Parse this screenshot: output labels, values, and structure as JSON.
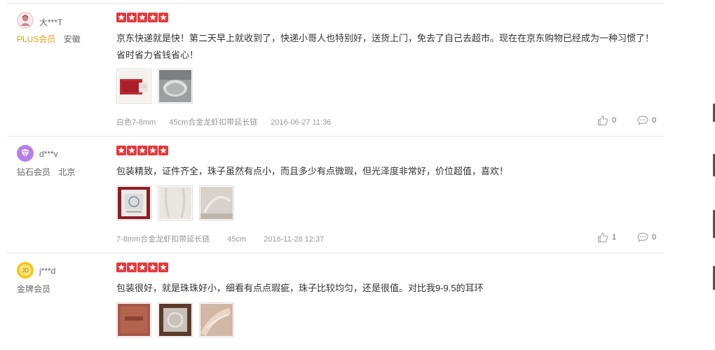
{
  "reviews": [
    {
      "user": "大***T",
      "level": "PLUS会员",
      "location": "安徽",
      "rating": 5,
      "content": "京东快递就是快！第二天早上就收到了，快递小哥人也特别好，送货上门，免去了自己去超市。现在在京东购物已经成为一种习惯了！省时省力省钱省心！",
      "specs": [
        "白色7-8mm",
        "45cm合金龙虾扣带延长链"
      ],
      "date": "2016-06-27 11:36",
      "likes": "0",
      "replies": "0"
    },
    {
      "user": "d***v",
      "level": "钻石会员",
      "location": "北京",
      "rating": 5,
      "content": "包装精致，证件齐全，珠子虽然有点小，而且多少有点微瑕，但光泽度非常好，价位超值，喜欢！",
      "specs": [
        "7-8mm合金龙虾扣带延长链",
        "45cm"
      ],
      "date": "2016-11-28 12:37",
      "likes": "1",
      "replies": "0"
    },
    {
      "user": "j***d",
      "level": "金牌会员",
      "location": "",
      "rating": 5,
      "content": "包装很好，就是珠珠好小，细看有点点瑕疵，珠子比较均匀，还是很值。对比我9-9.5的耳环"
    }
  ],
  "colors": {
    "star": "#e4393c",
    "plus": "#e4a01b",
    "diamond": "#b57ee8",
    "gold": "#f5c518"
  },
  "icons": {
    "like": "thumbs-up-icon",
    "reply": "comment-icon"
  }
}
